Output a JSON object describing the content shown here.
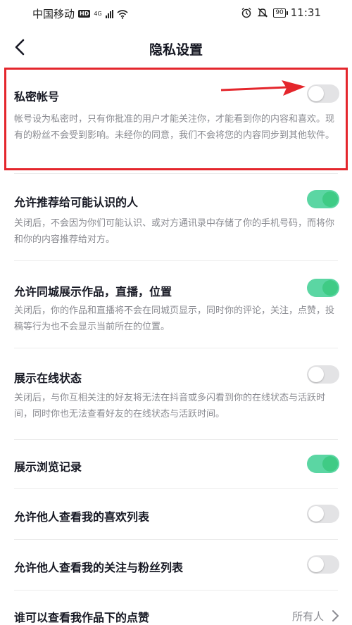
{
  "status_bar": {
    "carrier": "中国移动",
    "hd": "HD",
    "network": "4G",
    "battery": "90",
    "time": "11:31",
    "icons": [
      "signal-icon",
      "wifi-icon",
      "alarm-icon",
      "mute-icon",
      "battery-icon"
    ]
  },
  "nav": {
    "title": "隐私设置",
    "back_icon": "back-chevron-icon"
  },
  "settings": [
    {
      "title": "私密帐号",
      "desc": "帐号设为私密时，只有你批准的用户才能关注你，才能看到你的内容和喜欢。现有的粉丝不会受到影响。未经你的同意，我们不会将您的内容同步到其他软件。",
      "enabled": false
    },
    {
      "title": "允许推荐给可能认识的人",
      "desc": "关闭后，不会因为你们可能认识、或对方通讯录中存储了你的手机号码，而将你和你的内容推荐给对方。",
      "enabled": true
    },
    {
      "title": "允许同城展示作品，直播，位置",
      "desc": "关闭后，你的作品和直播将不会在同城页显示，同时你的评论，关注，点赞，投稿等行为也不会显示当前所在的位置。",
      "enabled": true
    },
    {
      "title": "展示在线状态",
      "desc": "关闭后，与你互相关注的好友将无法在抖音或多闪看到你的在线状态与活跃时间，同时你也无法查看好友的在线状态与活跃时间。",
      "enabled": false
    },
    {
      "title": "展示浏览记录",
      "enabled": true
    },
    {
      "title": "允许他人查看我的喜欢列表",
      "enabled": false
    },
    {
      "title": "允许他人查看我的关注与粉丝列表",
      "enabled": false
    },
    {
      "title": "谁可以查看我作品下的点赞",
      "value": "所有人"
    }
  ],
  "colors": {
    "toggle_on": "#5bd6a3",
    "toggle_off": "#e3e3e5",
    "highlight": "#e4262c",
    "desc_text": "#8a8b91"
  }
}
